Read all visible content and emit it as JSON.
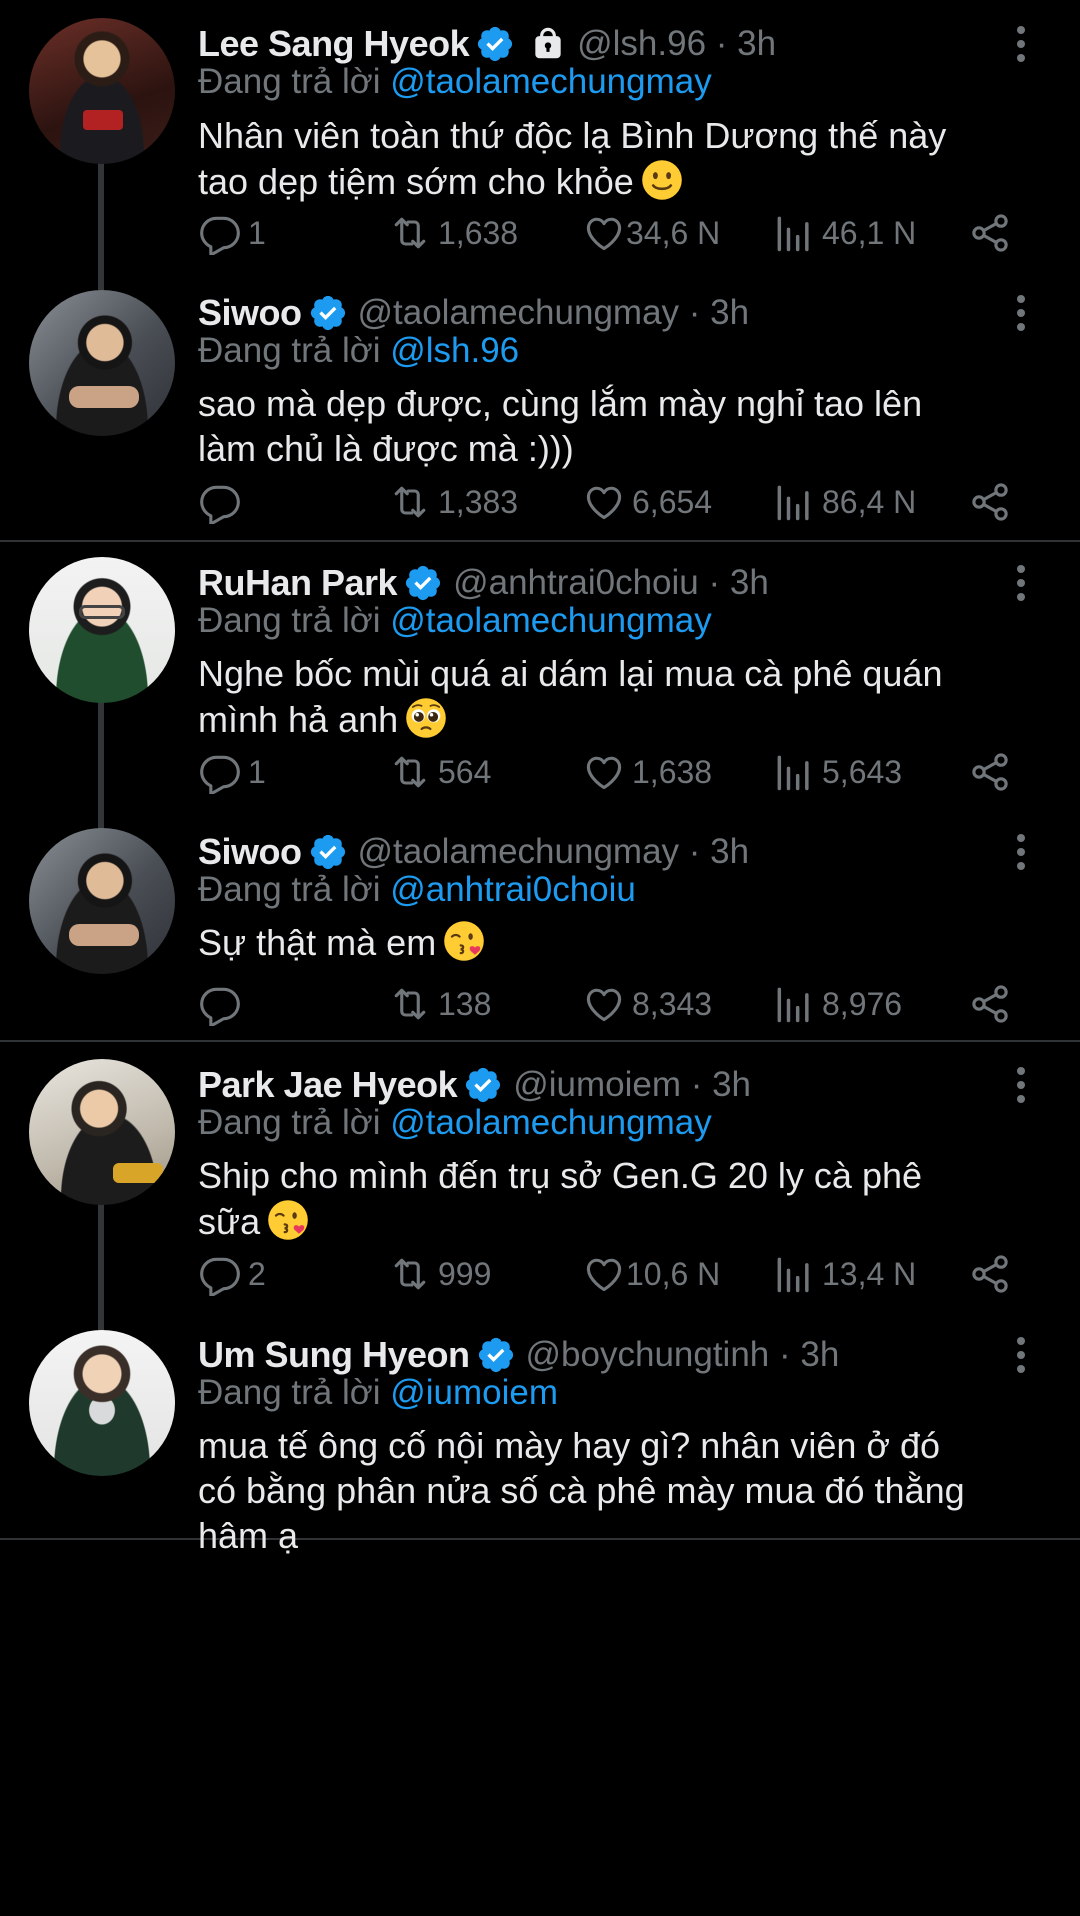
{
  "reply_prefix": "Đang trả lời",
  "tweets": [
    {
      "name": "Lee Sang Hyeok",
      "meta": "@lsh.96 · 3h",
      "reply_to": "@taolamechungmay",
      "text_lines": [
        "Nhân viên toàn thứ độc lạ Bình Dương thế này",
        "tao dẹp tiệm sớm cho khỏe"
      ],
      "emoji": "slightly-smiling-face",
      "replies": "1",
      "retweets": "1,638",
      "likes": "34,6 N",
      "views": "46,1 N"
    },
    {
      "name": "Siwoo",
      "meta": "@taolamechungmay · 3h",
      "reply_to": "@lsh.96",
      "text_lines": [
        "sao mà dẹp được, cùng lắm mày nghỉ tao lên",
        "làm chủ là được mà :)))"
      ],
      "emoji": "",
      "replies": "",
      "retweets": "1,383",
      "likes": "6,654",
      "views": "86,4 N"
    },
    {
      "name": "RuHan Park",
      "meta": "@anhtrai0choiu · 3h",
      "reply_to": "@taolamechungmay",
      "text_lines": [
        "Nghe bốc mùi quá ai dám lại mua cà phê quán",
        "mình hả anh"
      ],
      "emoji": "pleading-face",
      "replies": "1",
      "retweets": "564",
      "likes": "1,638",
      "views": "5,643"
    },
    {
      "name": "Siwoo",
      "meta": "@taolamechungmay · 3h",
      "reply_to": "@anhtrai0choiu",
      "text_lines": [
        "Sự thật mà em"
      ],
      "emoji": "face-blowing-kiss",
      "replies": "",
      "retweets": "138",
      "likes": "8,343",
      "views": "8,976"
    },
    {
      "name": "Park Jae Hyeok",
      "meta": "@iumoiem · 3h",
      "reply_to": "@taolamechungmay",
      "text_lines": [
        "Ship cho mình đến trụ sở Gen.G 20 ly cà phê",
        "sữa"
      ],
      "emoji": "face-blowing-kiss",
      "replies": "2",
      "retweets": "999",
      "likes": "10,6 N",
      "views": "13,4 N"
    },
    {
      "name": "Um Sung Hyeon",
      "meta": "@boychungtinh · 3h",
      "reply_to": "@iumoiem",
      "text_lines": [
        "mua tế ông cố nội mày hay gì? nhân viên ở đó",
        "có bằng phân nửa số cà phê mày mua đó thằng",
        "hâm ạ"
      ],
      "emoji": "",
      "replies": "",
      "retweets": "",
      "likes": "",
      "views": ""
    }
  ],
  "colors": {
    "background": "#000000",
    "accent": "#1d9bf0",
    "muted": "#71767b",
    "text": "#e7e9ea"
  },
  "icons": [
    "verified-badge-icon",
    "lock-icon",
    "more-options-icon",
    "reply-icon",
    "retweet-icon",
    "like-icon",
    "views-icon",
    "share-icon"
  ]
}
